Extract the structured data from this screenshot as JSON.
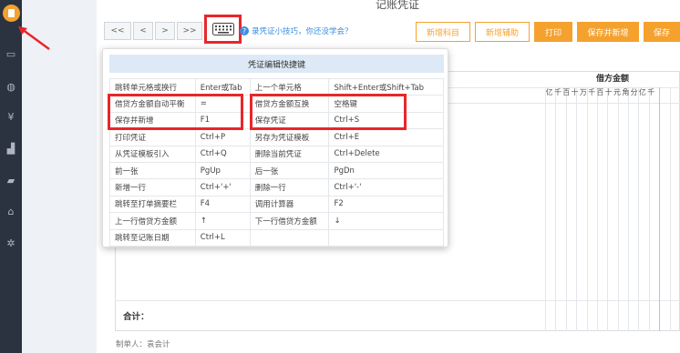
{
  "page": {
    "title": "记账凭证"
  },
  "sidebar": {
    "items": [
      {
        "icon": "voucher-icon",
        "glyph": "▮"
      },
      {
        "icon": "wallet-icon",
        "glyph": "▭"
      },
      {
        "icon": "moneybag-icon",
        "glyph": "◍"
      },
      {
        "icon": "yen-icon",
        "glyph": "¥"
      },
      {
        "icon": "report-icon",
        "glyph": "▟"
      },
      {
        "icon": "briefcase-icon",
        "glyph": "▰"
      },
      {
        "icon": "home-icon",
        "glyph": "⌂"
      },
      {
        "icon": "settings-icon",
        "glyph": "✲"
      }
    ]
  },
  "toolbar": {
    "first": "<<",
    "prev": "<",
    "next": ">",
    "last": ">>",
    "tip": "录凭证小技巧，你还没学会？",
    "add_subject": "新增科目",
    "add_aux": "新增辅助",
    "print": "打印",
    "save_new": "保存并新增",
    "save": "保存"
  },
  "table": {
    "debit_header": "借方金额",
    "digits": [
      "亿",
      "千",
      "百",
      "十",
      "万",
      "千",
      "百",
      "十",
      "元",
      "角",
      "分",
      "亿",
      "千"
    ],
    "total_label": "合计：",
    "maker": "制单人：袁会计"
  },
  "shortcut_panel": {
    "title": "凭证编辑快捷键",
    "rows": [
      [
        "跳转单元格或换行",
        "Enter或Tab",
        "上一个单元格",
        "Shift+Enter或Shift+Tab"
      ],
      [
        "借贷方金额自动平衡",
        "=",
        "借贷方金额互换",
        "空格键"
      ],
      [
        "保存并新增",
        "F1",
        "保存凭证",
        "Ctrl+S"
      ],
      [
        "打印凭证",
        "Ctrl+P",
        "另存为凭证模板",
        "Ctrl+E"
      ],
      [
        "从凭证模板引入",
        "Ctrl+Q",
        "删除当前凭证",
        "Ctrl+Delete"
      ],
      [
        "前一张",
        "PgUp",
        "后一张",
        "PgDn"
      ],
      [
        "新增一行",
        "Ctrl+'+'",
        "删除一行",
        "Ctrl+'-'"
      ],
      [
        "跳转至打单摘要栏",
        "F4",
        "调用计算器",
        "F2"
      ],
      [
        "上一行借贷方金额",
        "↑",
        "下一行借贷方金额",
        "↓"
      ],
      [
        "跳转至记账日期",
        "Ctrl+L",
        "",
        ""
      ]
    ]
  },
  "colors": {
    "accent": "#f5a12d",
    "sidebar": "#2b3340",
    "highlight": "#e8262b",
    "link": "#3d8de0"
  }
}
